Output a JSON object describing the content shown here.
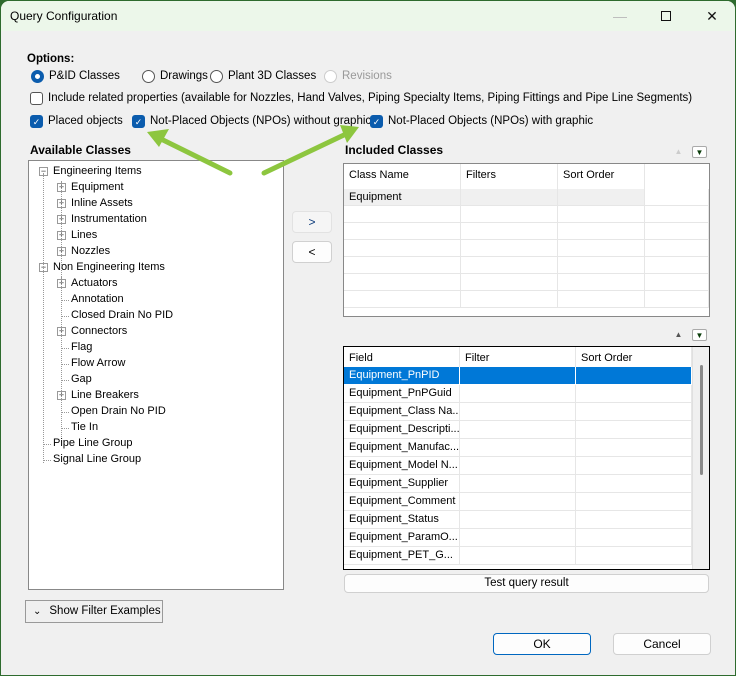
{
  "window": {
    "title": "Query Configuration"
  },
  "options": {
    "heading": "Options:",
    "source_radios": [
      {
        "label": "P&ID Classes",
        "selected": true,
        "enabled": true
      },
      {
        "label": "Drawings",
        "selected": false,
        "enabled": true
      },
      {
        "label": "Plant 3D Classes",
        "selected": false,
        "enabled": true
      },
      {
        "label": "Revisions",
        "selected": false,
        "enabled": false
      }
    ],
    "include_related": {
      "label": "Include related properties (available for Nozzles, Hand Valves, Piping Specialty Items, Piping Fittings and Pipe Line Segments)",
      "checked": false
    },
    "object_checks": [
      {
        "label": "Placed objects",
        "checked": true
      },
      {
        "label": "Not-Placed Objects (NPOs) without graphic",
        "checked": true
      },
      {
        "label": "Not-Placed Objects (NPOs) with graphic",
        "checked": true
      }
    ]
  },
  "available": {
    "heading": "Available Classes",
    "tree": [
      {
        "label": "Engineering Items",
        "level": 0,
        "expander": "minus"
      },
      {
        "label": "Equipment",
        "level": 1,
        "expander": "plus"
      },
      {
        "label": "Inline Assets",
        "level": 1,
        "expander": "plus"
      },
      {
        "label": "Instrumentation",
        "level": 1,
        "expander": "plus"
      },
      {
        "label": "Lines",
        "level": 1,
        "expander": "plus"
      },
      {
        "label": "Nozzles",
        "level": 1,
        "expander": "plus"
      },
      {
        "label": "Non Engineering Items",
        "level": 0,
        "expander": "minus"
      },
      {
        "label": "Actuators",
        "level": 1,
        "expander": "plus"
      },
      {
        "label": "Annotation",
        "level": 1,
        "expander": "none"
      },
      {
        "label": "Closed Drain No PID",
        "level": 1,
        "expander": "none"
      },
      {
        "label": "Connectors",
        "level": 1,
        "expander": "plus"
      },
      {
        "label": "Flag",
        "level": 1,
        "expander": "none"
      },
      {
        "label": "Flow Arrow",
        "level": 1,
        "expander": "none"
      },
      {
        "label": "Gap",
        "level": 1,
        "expander": "none"
      },
      {
        "label": "Line Breakers",
        "level": 1,
        "expander": "plus"
      },
      {
        "label": "Open Drain No PID",
        "level": 1,
        "expander": "none"
      },
      {
        "label": "Tie In",
        "level": 1,
        "expander": "none"
      },
      {
        "label": "Pipe Line Group",
        "level": 0,
        "expander": "none"
      },
      {
        "label": "Signal Line Group",
        "level": 0,
        "expander": "none"
      }
    ]
  },
  "transfer": {
    "add_label": ">",
    "remove_label": "<"
  },
  "included": {
    "heading": "Included Classes",
    "columns": [
      "Class Name",
      "Filters",
      "Sort Order"
    ],
    "rows": [
      [
        "Equipment",
        "",
        ""
      ]
    ]
  },
  "fields": {
    "columns": [
      "Field",
      "Filter",
      "Sort Order"
    ],
    "rows": [
      [
        "Equipment_PnPID",
        "",
        ""
      ],
      [
        "Equipment_PnPGuid",
        "",
        ""
      ],
      [
        "Equipment_Class Na...",
        "",
        ""
      ],
      [
        "Equipment_Descripti...",
        "",
        ""
      ],
      [
        "Equipment_Manufac...",
        "",
        ""
      ],
      [
        "Equipment_Model N...",
        "",
        ""
      ],
      [
        "Equipment_Supplier",
        "",
        ""
      ],
      [
        "Equipment_Comment",
        "",
        ""
      ],
      [
        "Equipment_Status",
        "",
        ""
      ],
      [
        "Equipment_ParamO...",
        "",
        ""
      ],
      [
        "Equipment_PET_G...",
        "",
        ""
      ]
    ],
    "selected_index": 0
  },
  "buttons": {
    "test_query": "Test query result",
    "show_filter_examples": "Show Filter Examples",
    "ok": "OK",
    "cancel": "Cancel"
  },
  "colors": {
    "accent": "#0078d7",
    "annotation_arrow": "#8dc63f",
    "checkbox": "#0b5cad"
  }
}
